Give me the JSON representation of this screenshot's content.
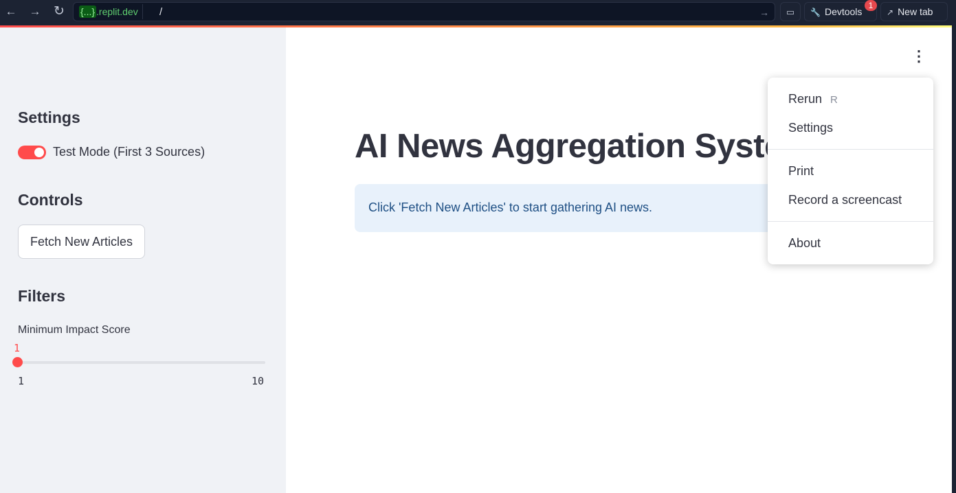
{
  "browser": {
    "url_host_badge": "{...}",
    "url_host_rest": ".replit.dev",
    "url_path": "/",
    "devtools_label": "Devtools",
    "devtools_badge": "1",
    "newtab_label": "New tab",
    "icons": [
      "back-icon",
      "forward-icon",
      "reload-icon",
      "arrow-right-icon",
      "monitor-icon",
      "wrench-icon",
      "external-link-icon"
    ]
  },
  "sidebar": {
    "settings_heading": "Settings",
    "test_mode_label": "Test Mode (First 3 Sources)",
    "test_mode_on": true,
    "controls_heading": "Controls",
    "fetch_button": "Fetch New Articles",
    "filters_heading": "Filters",
    "slider": {
      "label": "Minimum Impact Score",
      "value": "1",
      "min": "1",
      "max": "10"
    }
  },
  "main": {
    "title": "AI News Aggregation System",
    "info": "Click 'Fetch New Articles' to start gathering AI news."
  },
  "menu": {
    "items": [
      {
        "label": "Rerun",
        "shortcut": "R"
      },
      {
        "label": "Settings"
      },
      {
        "label": "Print"
      },
      {
        "label": "Record a screencast"
      },
      {
        "label": "About"
      }
    ]
  },
  "colors": {
    "accent": "#ff4b4b",
    "sidebar_bg": "#f0f2f6",
    "info_bg": "#e8f1fb",
    "topbar_bg": "#1c2333"
  }
}
